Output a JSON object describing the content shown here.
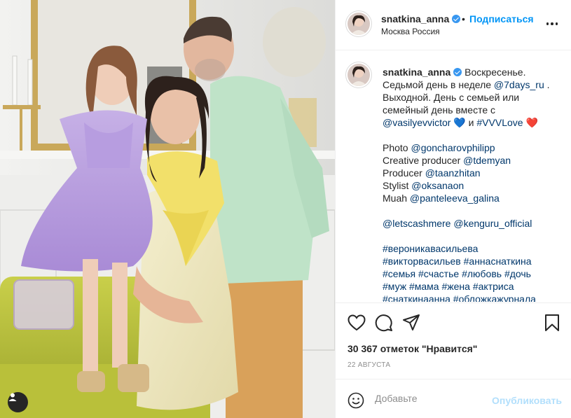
{
  "post": {
    "username": "snatkina_anna",
    "separator": "•",
    "follow_label": "Подписаться",
    "location": "Москва Россия",
    "caption": {
      "lines": [
        [
          {
            "t": "u",
            "v": "snatkina_anna"
          },
          {
            "t": "v"
          },
          {
            "t": "x",
            "v": " Воскресенье."
          }
        ],
        [
          {
            "t": "x",
            "v": "Седьмой день в неделе "
          },
          {
            "t": "m",
            "v": "@7days_ru"
          },
          {
            "t": "x",
            "v": " ."
          }
        ],
        [
          {
            "t": "x",
            "v": "Выходной. День с семьей или"
          }
        ],
        [
          {
            "t": "x",
            "v": "семейный день вместе с"
          }
        ],
        [
          {
            "t": "m",
            "v": "@vasilyevvictor"
          },
          {
            "t": "x",
            "v": " "
          },
          {
            "t": "hb",
            "v": "💙"
          },
          {
            "t": "x",
            "v": " и "
          },
          {
            "t": "m",
            "v": "#VVVLove"
          },
          {
            "t": "x",
            "v": " "
          },
          {
            "t": "hr",
            "v": "❤️"
          }
        ],
        [
          {
            "t": "x",
            "v": ""
          }
        ],
        [
          {
            "t": "x",
            "v": "Photo "
          },
          {
            "t": "m",
            "v": "@goncharovphilipp"
          }
        ],
        [
          {
            "t": "x",
            "v": "Creative producer "
          },
          {
            "t": "m",
            "v": "@tdemyan"
          }
        ],
        [
          {
            "t": "x",
            "v": "Producer "
          },
          {
            "t": "m",
            "v": "@taanzhitan"
          }
        ],
        [
          {
            "t": "x",
            "v": "Stylist "
          },
          {
            "t": "m",
            "v": "@oksanaon"
          }
        ],
        [
          {
            "t": "x",
            "v": "Muah "
          },
          {
            "t": "m",
            "v": "@panteleeva_galina"
          }
        ],
        [
          {
            "t": "x",
            "v": ""
          }
        ],
        [
          {
            "t": "m",
            "v": "@letscashmere"
          },
          {
            "t": "x",
            "v": " "
          },
          {
            "t": "m",
            "v": "@kenguru_official"
          }
        ],
        [
          {
            "t": "x",
            "v": ""
          }
        ],
        [
          {
            "t": "m",
            "v": "#вероникавасильева"
          }
        ],
        [
          {
            "t": "m",
            "v": "#викторвасильев"
          },
          {
            "t": "x",
            "v": " "
          },
          {
            "t": "m",
            "v": "#аннаснаткина"
          }
        ],
        [
          {
            "t": "m",
            "v": "#семья"
          },
          {
            "t": "x",
            "v": " "
          },
          {
            "t": "m",
            "v": "#счастье"
          },
          {
            "t": "x",
            "v": " "
          },
          {
            "t": "m",
            "v": "#любовь"
          },
          {
            "t": "x",
            "v": " "
          },
          {
            "t": "m",
            "v": "#дочь"
          }
        ],
        [
          {
            "t": "m",
            "v": "#муж"
          },
          {
            "t": "x",
            "v": " "
          },
          {
            "t": "m",
            "v": "#мама"
          },
          {
            "t": "x",
            "v": " "
          },
          {
            "t": "m",
            "v": "#жена"
          },
          {
            "t": "x",
            "v": " "
          },
          {
            "t": "m",
            "v": "#актриса"
          }
        ],
        [
          {
            "t": "m",
            "v": "#снаткинаанна"
          },
          {
            "t": "x",
            "v": " "
          },
          {
            "t": "m",
            "v": "#обложкажурнала"
          }
        ]
      ]
    },
    "likes_text": "30 367 отметок \"Нравится\"",
    "date": "22 АВГУСТА",
    "comment": {
      "placeholder": "Добавьте",
      "publish_label": "Опубликовать"
    }
  },
  "colors": {
    "accent": "#0095f6",
    "link": "#00376b",
    "muted": "#8e8e8e",
    "border": "#efefef",
    "publish_disabled": "#b2dffc"
  },
  "icons": [
    "verified-badge-icon",
    "more-options-icon",
    "heart-icon",
    "comment-icon",
    "share-icon",
    "bookmark-icon",
    "emoji-icon",
    "user-tag-icon"
  ]
}
